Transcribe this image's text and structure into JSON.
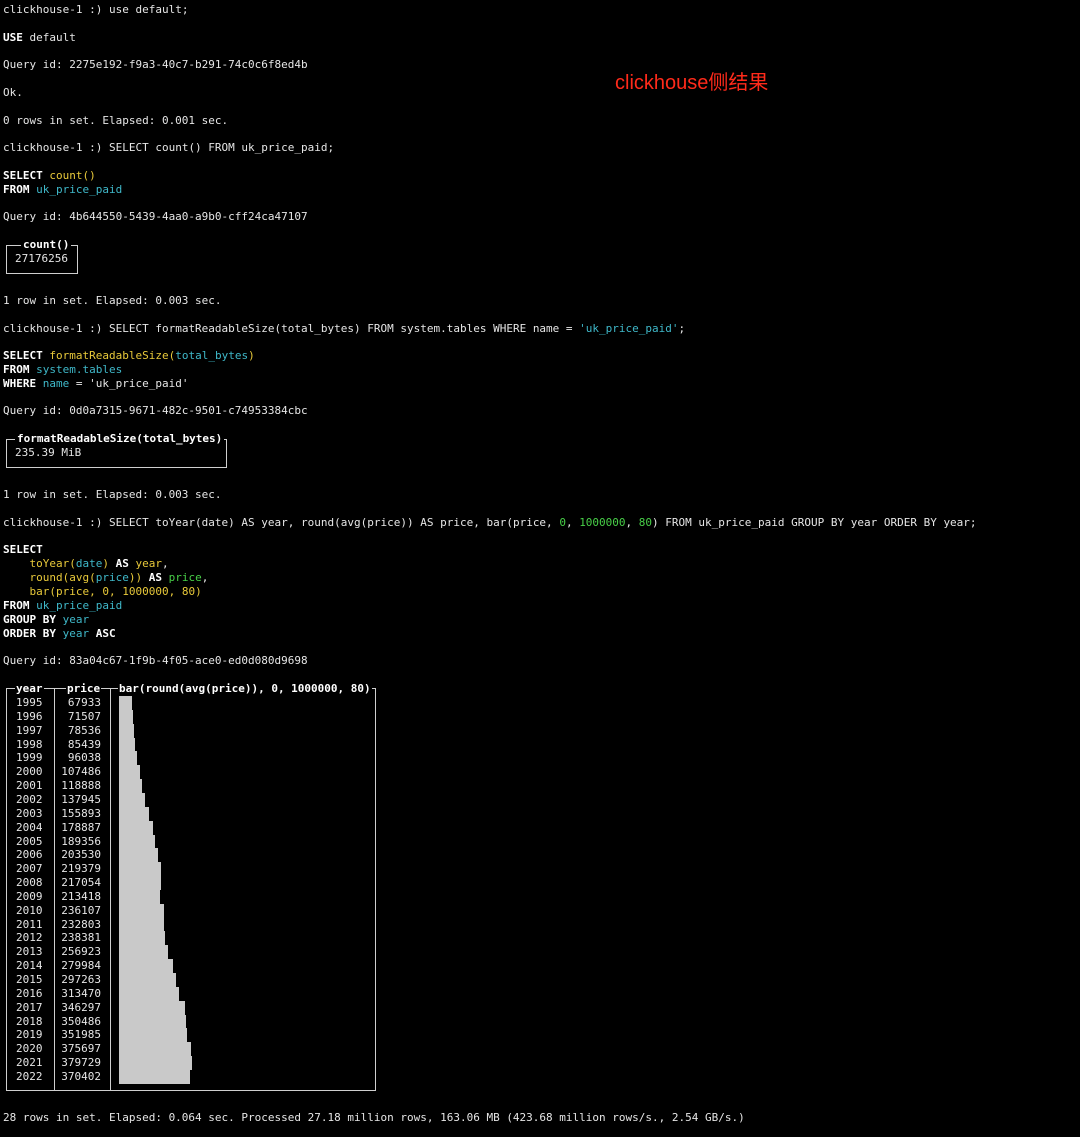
{
  "annotation": "clickhouse侧结果",
  "colors": {
    "keyword": "#ffffff",
    "function": "#e8c93a",
    "identifier": "#3fb8c9",
    "number": "#48d048",
    "bar": "#c9c9c9",
    "annotation": "#ff2a1a"
  },
  "session": {
    "prompt": "clickhouse-1 :)",
    "q1": {
      "cmd": "use default;",
      "echo_kw": "USE",
      "echo_rest": " default",
      "query_id": "Query id: 2275e192-f9a3-40c7-b291-74c0c6f8ed4b",
      "ok": "Ok.",
      "status": "0 rows in set. Elapsed: 0.001 sec."
    },
    "q2": {
      "cmd": "SELECT count() FROM uk_price_paid;",
      "select_kw": "SELECT",
      "select_fn": "count()",
      "from_kw": "FROM",
      "table": "uk_price_paid",
      "query_id": "Query id: 4b644550-5439-4aa0-a9b0-cff24ca47107",
      "result_header": "count()",
      "result_value": "27176256",
      "status": "1 row in set. Elapsed: 0.003 sec."
    },
    "q3": {
      "cmd_pre": "SELECT formatReadableSize(total_bytes) FROM system.tables WHERE name = ",
      "cmd_str": "'uk_price_paid'",
      "cmd_end": ";",
      "select_kw": "SELECT",
      "fn": "formatReadableSize(",
      "arg": "total_bytes",
      "fn_close": ")",
      "from_kw": "FROM",
      "table": "system.tables",
      "where_kw": "WHERE",
      "col": "name",
      "eq": " = ",
      "val": "'uk_price_paid'",
      "query_id": "Query id: 0d0a7315-9671-482c-9501-c74953384cbc",
      "result_header": "formatReadableSize(total_bytes)",
      "result_value": "235.39 MiB",
      "status": "1 row in set. Elapsed: 0.003 sec."
    },
    "q4": {
      "cmd_a": "SELECT toYear(date) AS year, round(avg(price)) AS price, bar(price, ",
      "cmd_n1": "0",
      "cmd_c1": ", ",
      "cmd_n2": "1000000",
      "cmd_c2": ", ",
      "cmd_n3": "80",
      "cmd_b": ") FROM uk_price_paid GROUP BY year ORDER BY year;",
      "select_kw": "SELECT",
      "l1_fn1": "toYear(",
      "l1_arg": "date",
      "l1_fn2": ")",
      "l1_as": " AS ",
      "l1_alias": "year",
      "l1_comma": ",",
      "l2_fn": "round(avg(",
      "l2_arg": "price",
      "l2_close": "))",
      "l2_as": " AS ",
      "l2_alias": "price",
      "l2_comma": ",",
      "l3_fn": "bar(",
      "l3_args": "price, 0, 1000000, 80",
      "l3_close": ")",
      "from_kw": "FROM",
      "table": "uk_price_paid",
      "group_kw": "GROUP BY",
      "group_col": "year",
      "order_kw": "ORDER BY",
      "order_col": "year",
      "order_dir": "ASC",
      "query_id": "Query id: 83a04c67-1f9b-4f05-ace0-ed0d080d9698",
      "status": "28 rows in set. Elapsed: 0.064 sec. Processed 27.18 million rows, 163.06 MB (423.68 million rows/s., 2.54 GB/s.)"
    }
  },
  "chart_data": {
    "type": "table",
    "columns": [
      "year",
      "price",
      "bar(round(avg(price)), 0, 1000000, 80)"
    ],
    "bar_range": [
      0,
      1000000
    ],
    "bar_width_chars": 80,
    "rows": [
      {
        "year": "1995",
        "price": 67933
      },
      {
        "year": "1996",
        "price": 71507
      },
      {
        "year": "1997",
        "price": 78536
      },
      {
        "year": "1998",
        "price": 85439
      },
      {
        "year": "1999",
        "price": 96038
      },
      {
        "year": "2000",
        "price": 107486
      },
      {
        "year": "2001",
        "price": 118888
      },
      {
        "year": "2002",
        "price": 137945
      },
      {
        "year": "2003",
        "price": 155893
      },
      {
        "year": "2004",
        "price": 178887
      },
      {
        "year": "2005",
        "price": 189356
      },
      {
        "year": "2006",
        "price": 203530
      },
      {
        "year": "2007",
        "price": 219379
      },
      {
        "year": "2008",
        "price": 217054
      },
      {
        "year": "2009",
        "price": 213418
      },
      {
        "year": "2010",
        "price": 236107
      },
      {
        "year": "2011",
        "price": 232803
      },
      {
        "year": "2012",
        "price": 238381
      },
      {
        "year": "2013",
        "price": 256923
      },
      {
        "year": "2014",
        "price": 279984
      },
      {
        "year": "2015",
        "price": 297263
      },
      {
        "year": "2016",
        "price": 313470
      },
      {
        "year": "2017",
        "price": 346297
      },
      {
        "year": "2018",
        "price": 350486
      },
      {
        "year": "2019",
        "price": 351985
      },
      {
        "year": "2020",
        "price": 375697
      },
      {
        "year": "2021",
        "price": 379729
      },
      {
        "year": "2022",
        "price": 370402
      }
    ]
  }
}
